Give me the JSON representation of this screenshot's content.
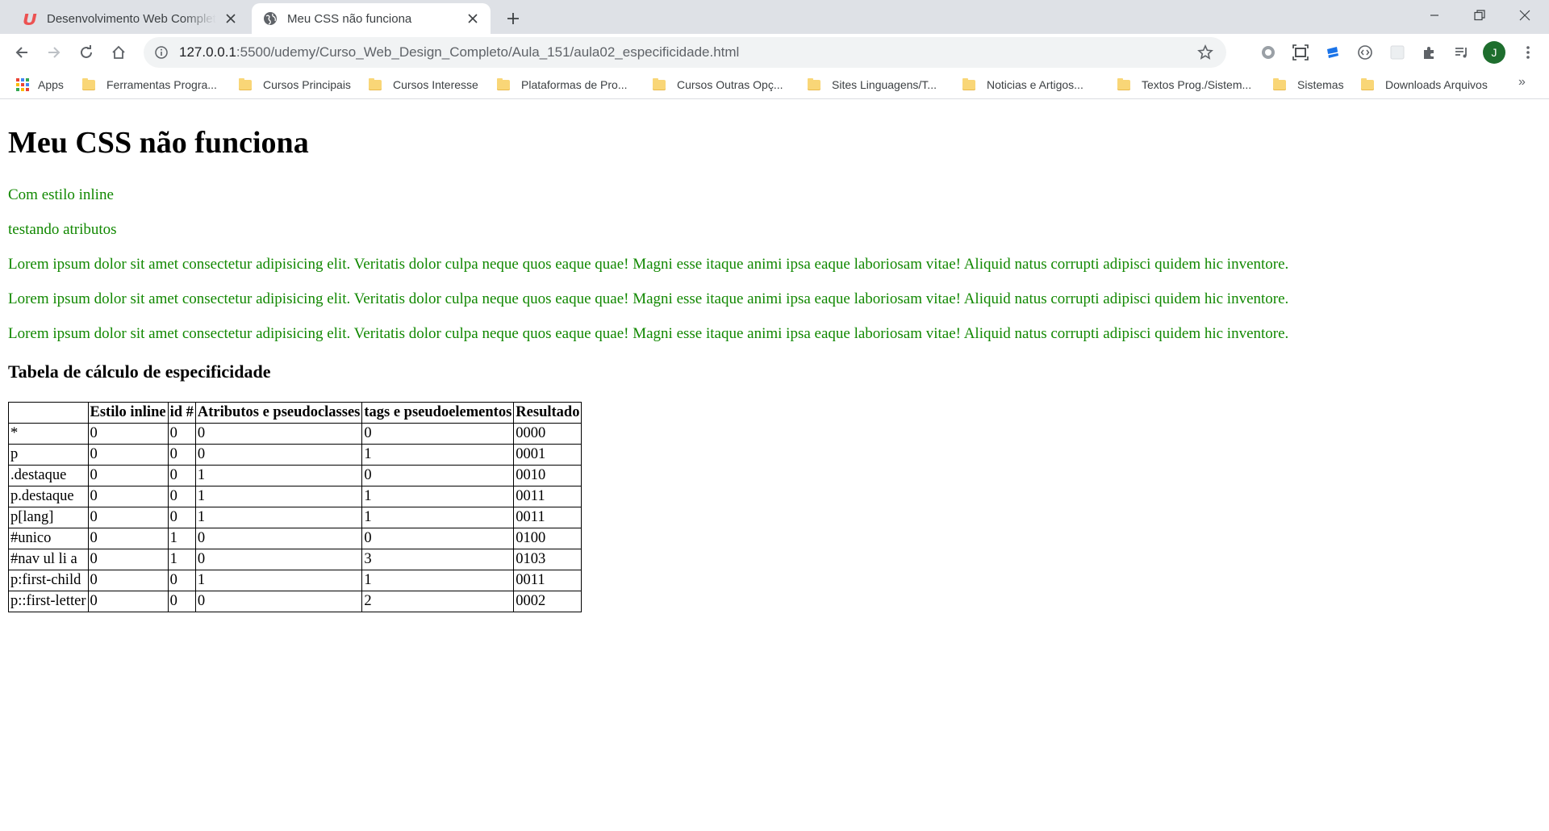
{
  "tabs": [
    {
      "title": "Desenvolvimento Web Completo",
      "favicon": "udemy-icon",
      "active": false
    },
    {
      "title": "Meu CSS não funciona",
      "favicon": "globe-icon",
      "active": true
    }
  ],
  "address": {
    "host": "127.0.0.1",
    "path": ":5500/udemy/Curso_Web_Design_Completo/Aula_151/aula02_especificidade.html"
  },
  "avatar_letter": "J",
  "bookmarks": {
    "apps_label": "Apps",
    "items": [
      "Ferramentas Progra...",
      "Cursos Principais",
      "Cursos Interesse",
      "Plataformas de Pro...",
      "Cursos Outras Opç...",
      "Sites Linguagens/T...",
      "Noticias e Artigos...",
      "Textos Prog./Sistem...",
      "Sistemas",
      "Downloads Arquivos"
    ],
    "more": "»"
  },
  "page": {
    "heading": "Meu CSS não funciona",
    "paragraphs": [
      "Com estilo inline",
      "testando atributos",
      "Lorem ipsum dolor sit amet consectetur adipisicing elit. Veritatis dolor culpa neque quos eaque quae! Magni esse itaque animi ipsa eaque laboriosam vitae! Aliquid natus corrupti adipisci quidem hic inventore.",
      "Lorem ipsum dolor sit amet consectetur adipisicing elit. Veritatis dolor culpa neque quos eaque quae! Magni esse itaque animi ipsa eaque laboriosam vitae! Aliquid natus corrupti adipisci quidem hic inventore.",
      "Lorem ipsum dolor sit amet consectetur adipisicing elit. Veritatis dolor culpa neque quos eaque quae! Magni esse itaque animi ipsa eaque laboriosam vitae! Aliquid natus corrupti adipisci quidem hic inventore."
    ],
    "paragraph_color": "#118800",
    "table_title": "Tabela de cálculo de especificidade",
    "table": {
      "headers": [
        "",
        "Estilo inline",
        "id #",
        "Atributos e pseudoclasses",
        "tags e pseudoelementos",
        "Resultado"
      ],
      "rows": [
        [
          "*",
          "0",
          "0",
          "0",
          "0",
          "0000"
        ],
        [
          "p",
          "0",
          "0",
          "0",
          "1",
          "0001"
        ],
        [
          ".destaque",
          "0",
          "0",
          "1",
          "0",
          "0010"
        ],
        [
          "p.destaque",
          "0",
          "0",
          "1",
          "1",
          "0011"
        ],
        [
          "p[lang]",
          "0",
          "0",
          "1",
          "1",
          "0011"
        ],
        [
          "#unico",
          "0",
          "1",
          "0",
          "0",
          "0100"
        ],
        [
          "#nav ul li a",
          "0",
          "1",
          "0",
          "3",
          "0103"
        ],
        [
          "p:first-child",
          "0",
          "0",
          "1",
          "1",
          "0011"
        ],
        [
          "p::first-letter",
          "0",
          "0",
          "0",
          "2",
          "0002"
        ]
      ]
    }
  }
}
